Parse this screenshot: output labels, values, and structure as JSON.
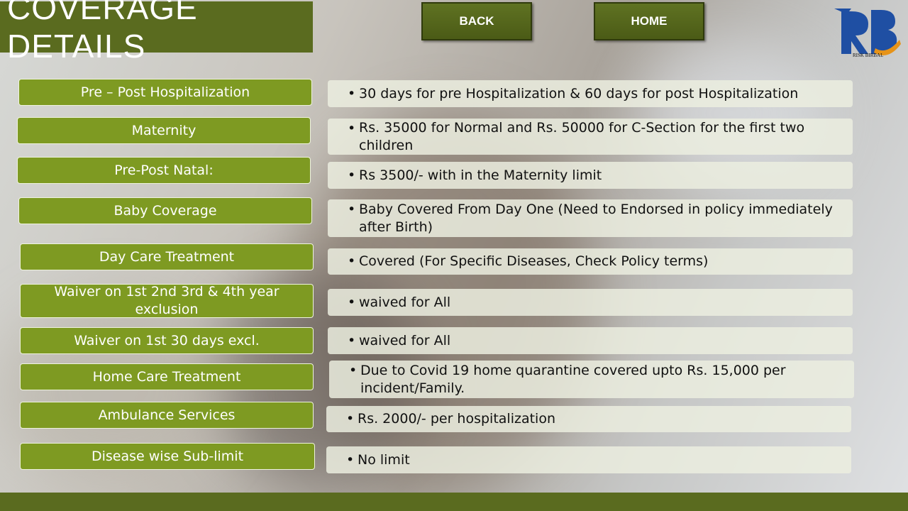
{
  "title": "COVERAGE DETAILS",
  "nav": {
    "back": "BACK",
    "home": "HOME"
  },
  "logo": {
    "initials": "RB",
    "text": "RISK BIRBAL"
  },
  "colors": {
    "brand_green": "#5a6b1f",
    "label_green": "#7e9a22",
    "logo_blue": "#1f4fa3",
    "logo_orange": "#e69318"
  },
  "rows": [
    {
      "label": "Pre – Post Hospitalization",
      "value": "30 days for pre Hospitalization & 60 days for post Hospitalization"
    },
    {
      "label": "Maternity",
      "value": "Rs. 35000 for Normal and Rs. 50000 for C-Section for the first two children"
    },
    {
      "label": "Pre-Post Natal:",
      "value": "Rs 3500/- with in the Maternity limit"
    },
    {
      "label": "Baby Coverage",
      "value": "Baby Covered From Day One (Need to Endorsed in policy immediately after Birth)"
    },
    {
      "label": "Day Care Treatment",
      "value": "Covered (For Specific Diseases, Check Policy terms)"
    },
    {
      "label": "Waiver on 1st 2nd 3rd & 4th year exclusion",
      "value": "waived for All"
    },
    {
      "label": "Waiver on 1st 30 days excl.",
      "value": "waived for All"
    },
    {
      "label": "Home Care Treatment",
      "value": "Due to Covid 19 home quarantine covered upto Rs. 15,000 per incident/Family."
    },
    {
      "label": "Ambulance Services",
      "value": "Rs. 2000/- per hospitalization"
    },
    {
      "label": "Disease wise Sub-limit",
      "value": "No limit"
    }
  ]
}
